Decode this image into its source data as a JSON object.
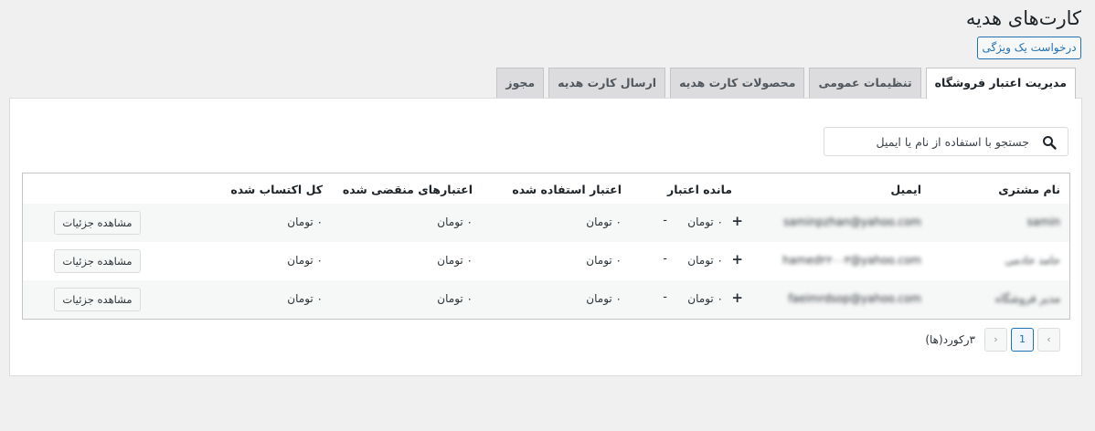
{
  "page": {
    "title": "کارت‌های هدیه",
    "feature_request": "درخواست یک ویژگی"
  },
  "tabs": [
    "مدیریت اعتبار فروشگاه",
    "تنظیمات عمومی",
    "محصولات کارت هدیه",
    "ارسال کارت هدیه",
    "مجوز"
  ],
  "active_tab": "مدیریت اعتبار فروشگاه",
  "search": {
    "placeholder": "جستجو با استفاده از نام یا ایمیل",
    "icon": "search-icon"
  },
  "table": {
    "headers": {
      "name": "نام مشتری",
      "email": "ایمیل",
      "balance": "مانده اعتبار",
      "used": "اعتبار استفاده شده",
      "expired": "اعتبارهای منقضی شده",
      "earned": "کل اکتساب شده"
    },
    "rows": [
      {
        "name": "samin",
        "email": "saminpzhan@yahoo.com",
        "balance": "۰ تومان",
        "used": "۰ تومان",
        "expired": "۰ تومان",
        "earned": "۰ تومان",
        "plus": "+",
        "minus": "-",
        "action": "مشاهده جزئیات"
      },
      {
        "name": "حامد خادمی",
        "email": "hamed۲۲۰۰۳@yahoo.com",
        "balance": "۰ تومان",
        "used": "۰ تومان",
        "expired": "۰ تومان",
        "earned": "۰ تومان",
        "plus": "+",
        "minus": "-",
        "action": "مشاهده جزئیات"
      },
      {
        "name": "مدیر فروشگاه",
        "email": "faeimrdsop@yahoo.com",
        "balance": "۰ تومان",
        "used": "۰ تومان",
        "expired": "۰ تومان",
        "earned": "۰ تومان",
        "plus": "+",
        "minus": "-",
        "action": "مشاهده جزئیات"
      }
    ]
  },
  "pagination": {
    "prev": "‹",
    "current": "1",
    "next": "›",
    "count_text": "۳رکورد(ها)"
  },
  "colors": {
    "accent": "#2271b1",
    "background": "#f0f0f1",
    "panel": "#ffffff"
  }
}
